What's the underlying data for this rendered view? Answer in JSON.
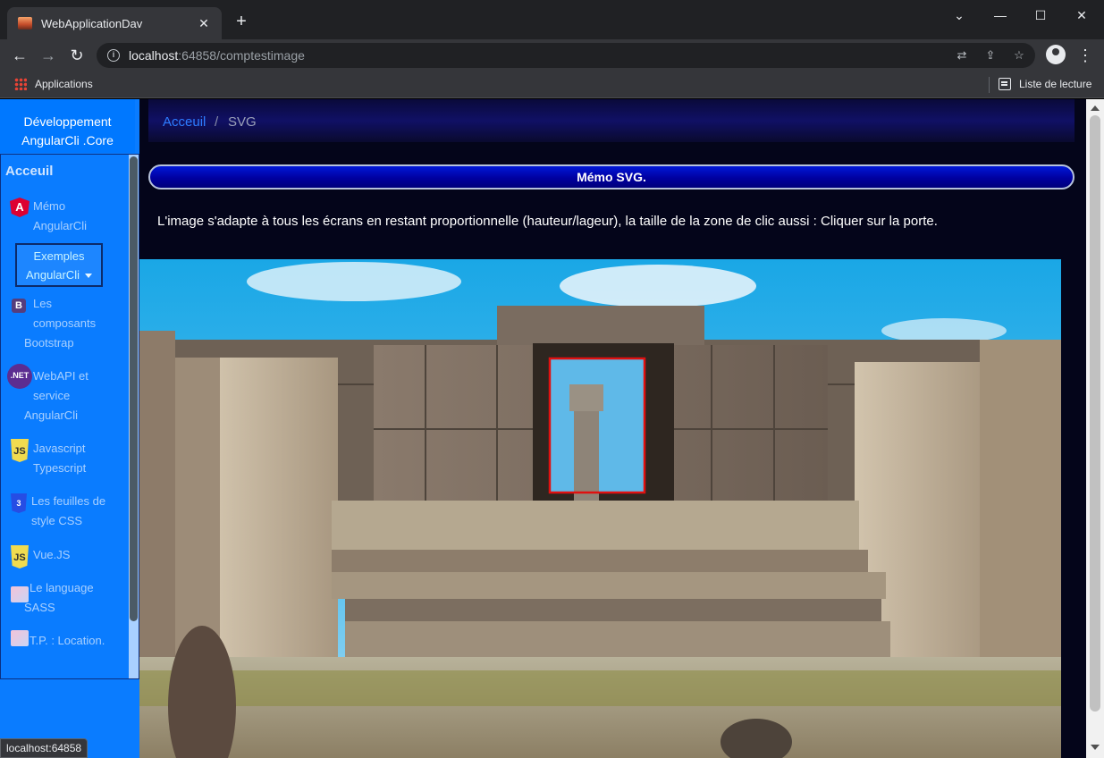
{
  "browser": {
    "tab_title": "WebApplicationDav",
    "tab_close": "✕",
    "new_tab": "+",
    "url_host": "localhost",
    "url_rest": ":64858/comptestimage",
    "bookmarks_label": "Applications",
    "reading_list_label": "Liste de lecture",
    "status_url": "localhost:64858"
  },
  "sidebar": {
    "brand_line1": "Développement",
    "brand_line2": "AngularCli .Core",
    "heading": "Acceuil",
    "items": [
      {
        "line1": "Mémo",
        "line2": "AngularCli",
        "icon": "angular-icon",
        "glyph": "A"
      },
      {
        "line1": "Exemples",
        "line2": "AngularCli",
        "icon": "dropdown"
      },
      {
        "line1": "Les",
        "line2": "composants",
        "line3": "Bootstrap",
        "icon": "bootstrap-icon",
        "glyph": "B"
      },
      {
        "line1": "WebAPI et",
        "line2": "service",
        "line3": "AngularCli",
        "icon": "dotnet-icon",
        "glyph": ".NET"
      },
      {
        "line1": "Javascript",
        "line2": "Typescript",
        "icon": "javascript-icon",
        "glyph": "JS"
      },
      {
        "line1": "Les feuilles de",
        "line2": "style CSS",
        "icon": "css-icon",
        "glyph": "3"
      },
      {
        "line1": "Vue.JS",
        "icon": "vuejs-icon",
        "glyph": "JS"
      },
      {
        "line1": "Le language",
        "line2": "SASS",
        "icon": "sass-icon"
      },
      {
        "line1": "T.P. : Location.",
        "icon": "location-icon"
      }
    ]
  },
  "breadcrumb": {
    "home": "Acceuil",
    "separator": "/",
    "current": "SVG"
  },
  "main": {
    "banner": "Mémo SVG.",
    "description": "L'image s'adapte à tous les écrans en restant proportionnelle (hauteur/lageur), la taille de la zone de clic aussi : Cliquer sur la porte."
  },
  "colors": {
    "sidebar": "#0a7cff",
    "banner": "#0000c8",
    "page_bg": "#04051a",
    "clickzone": "#e01010"
  }
}
